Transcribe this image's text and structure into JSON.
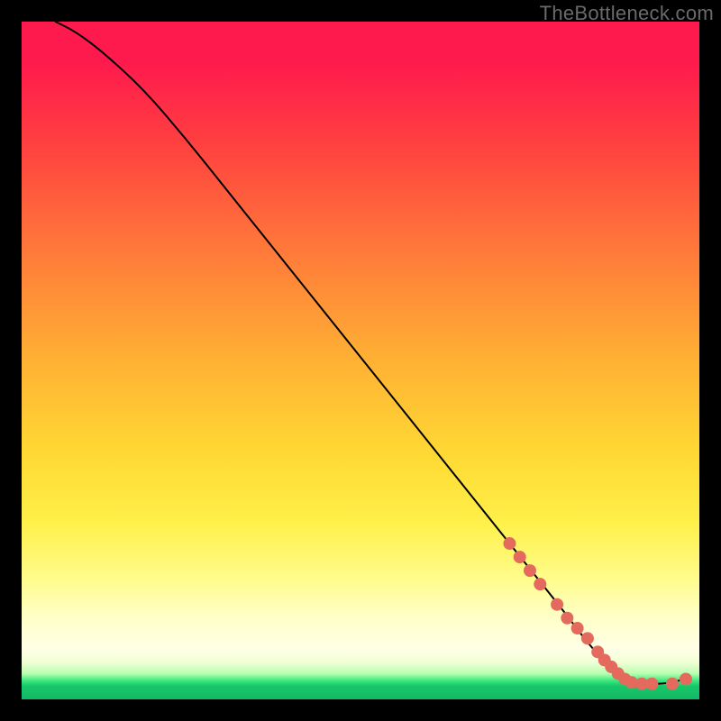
{
  "watermark": "TheBottleneck.com",
  "chart_data": {
    "type": "line",
    "title": "",
    "xlabel": "",
    "ylabel": "",
    "xlim": [
      0,
      100
    ],
    "ylim": [
      0,
      100
    ],
    "grid": false,
    "axes_hidden": true,
    "series": [
      {
        "name": "curve",
        "stroke": "#000000",
        "stroke_width": 2,
        "x": [
          5,
          8,
          12,
          18,
          24,
          30,
          36,
          42,
          48,
          54,
          60,
          66,
          72,
          76,
          80,
          83,
          86,
          89,
          92,
          95,
          98
        ],
        "y": [
          100,
          98.5,
          95.5,
          90,
          83,
          75.5,
          68,
          60.5,
          53,
          45.5,
          38,
          30.5,
          23,
          18,
          13,
          9,
          5.5,
          3,
          2.3,
          2.3,
          3
        ]
      }
    ],
    "markers": {
      "name": "highlighted-points",
      "color": "#e36a5c",
      "radius_px": 7,
      "x": [
        72,
        73.5,
        75,
        76.5,
        79,
        80.5,
        82,
        83.5,
        85,
        86,
        87,
        88,
        89,
        90,
        91.5,
        93,
        96,
        98
      ],
      "y": [
        23,
        21,
        19,
        17,
        14,
        12,
        10.5,
        9,
        7,
        5.8,
        4.8,
        3.8,
        3,
        2.5,
        2.3,
        2.3,
        2.3,
        3
      ]
    },
    "background": {
      "type": "vertical-gradient",
      "stops": [
        {
          "pos": 0.0,
          "color": "#ff1a4d"
        },
        {
          "pos": 0.18,
          "color": "#ff4040"
        },
        {
          "pos": 0.34,
          "color": "#ff7a3a"
        },
        {
          "pos": 0.5,
          "color": "#ffb134"
        },
        {
          "pos": 0.64,
          "color": "#ffd933"
        },
        {
          "pos": 0.82,
          "color": "#fffc8a"
        },
        {
          "pos": 0.93,
          "color": "#ffffe6"
        },
        {
          "pos": 0.97,
          "color": "#37e67a"
        },
        {
          "pos": 1.0,
          "color": "#13b964"
        }
      ]
    }
  }
}
